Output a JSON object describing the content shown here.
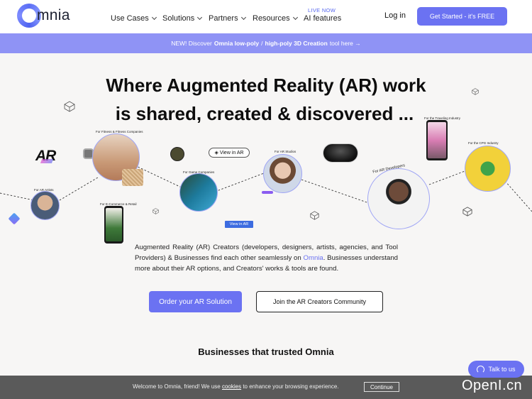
{
  "header": {
    "logo_text": "mnia",
    "nav": [
      {
        "label": "Use Cases"
      },
      {
        "label": "Solutions"
      },
      {
        "label": "Partners"
      },
      {
        "label": "Resources"
      }
    ],
    "live_badge": "LIVE NOW",
    "ai_features": "AI features",
    "login": "Log in",
    "cta": "Get Started - it's FREE"
  },
  "banner": {
    "prefix": "NEW! Discover",
    "bold1": "Omnia low-poly",
    "sep": "/",
    "bold2": "high-poly 3D Creation",
    "suffix": "tool here →"
  },
  "hero": {
    "title_line1": "Where Augmented Reality (AR) work",
    "title_line2": "is shared, created & discovered ...",
    "desc_part1": "Augmented Reality (AR) Creators (developers, designers, artists, agencies, and Tool Providers) & Businesses find each other seamlessly on ",
    "desc_link": "Omnia",
    "desc_part2": ". Businesses understand more about their AR options, and Creators' works & tools are found.",
    "btn_primary": "Order your AR Solution",
    "btn_secondary": "Join the AR Creators Community"
  },
  "graphic": {
    "ar_text": "AR",
    "view_in_ar": "View in AR",
    "view_in_ar_small": "View in AR",
    "labels": {
      "for_ar_artists": "For AR Artists",
      "for_fitness": "For Fitness & Fitness Companies",
      "for_ecommerce": "For E-Commerce & Retail",
      "for_game": "For Game Companies",
      "for_ar_studios": "For AR Studios",
      "for_ar_developers": "For AR Developers",
      "for_fmcg": "For the CPG Industry",
      "for_travel": "For the Traveling Industry"
    }
  },
  "trusted_title": "Businesses that trusted Omnia",
  "talk_button": "Talk to us",
  "cookie": {
    "text_before": "Welcome to Omnia, friend! We use ",
    "link": "cookies",
    "text_after": " to enhance your browsing experience.",
    "button": "Continue"
  },
  "watermark": "OpenI.cn"
}
